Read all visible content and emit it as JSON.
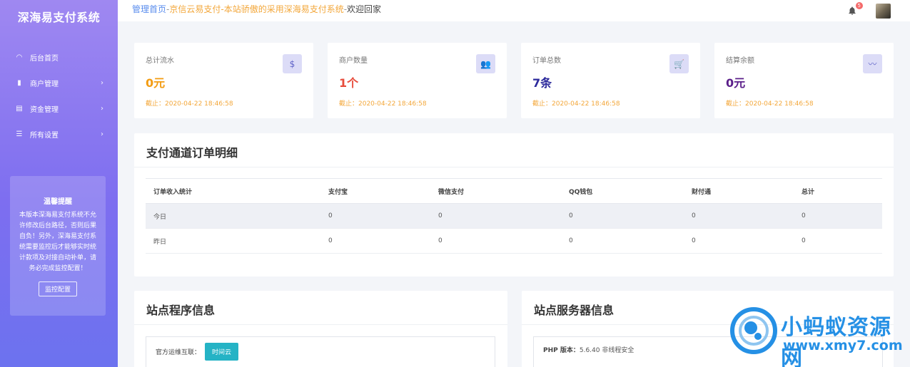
{
  "sidebar": {
    "brand": "深海易支付系统",
    "items": [
      {
        "label": "后台首页",
        "icon": "dashboard-icon",
        "chevron": ""
      },
      {
        "label": "商户管理",
        "icon": "bar-chart-icon",
        "chevron": "›"
      },
      {
        "label": "资金管理",
        "icon": "document-icon",
        "chevron": "›"
      },
      {
        "label": "所有设置",
        "icon": "list-icon",
        "chevron": "›"
      }
    ],
    "tip": {
      "title": "温馨提醒",
      "text": "本版本深海易支付系统不允许修改后台路径，否则后果自负！另外，深海易支付系统需要监控后才能够实时统计款项及对接自动补单，请务必完成监控配置！",
      "button": "监控配置"
    }
  },
  "topbar": {
    "breadcrumb_home": "管理首页",
    "sep1": "-",
    "site": "京信云易支付-本站骄傲的采用深海易支付系统",
    "sep2": "-",
    "welcome": "欢迎回家",
    "notification_count": "5"
  },
  "stats": [
    {
      "label": "总计流水",
      "value": "0元",
      "since": "截止：2020-04-22 18:46:58",
      "icon": "$",
      "color": "#f39c12"
    },
    {
      "label": "商户数量",
      "value": "1个",
      "since": "截止：2020-04-22 18:46:58",
      "icon": "👥",
      "color": "#e74c3c"
    },
    {
      "label": "订单总数",
      "value": "7条",
      "since": "截止：2020-04-22 18:46:58",
      "icon": "🛒",
      "color": "#2c2a9c"
    },
    {
      "label": "结算余额",
      "value": "0元",
      "since": "截止：2020-04-22 18:46:58",
      "icon": "〰",
      "color": "#5b1f8a"
    }
  ],
  "detail": {
    "title": "支付通道订单明细",
    "columns": [
      "订单收入统计",
      "支付宝",
      "微信支付",
      "QQ钱包",
      "财付通",
      "总计"
    ],
    "rows": [
      [
        "今日",
        "0",
        "0",
        "0",
        "0",
        "0"
      ],
      [
        "昨日",
        "0",
        "0",
        "0",
        "0",
        "0"
      ]
    ]
  },
  "site_program": {
    "title": "站点程序信息",
    "label": "官方运维互联：",
    "button": "时间云"
  },
  "site_server": {
    "title": "站点服务器信息",
    "php_label": "PHP 版本：",
    "php_value": "5.6.40 非线程安全"
  },
  "watermark": {
    "text": "小蚂蚁资源网",
    "url": "www.xmy7.com"
  }
}
